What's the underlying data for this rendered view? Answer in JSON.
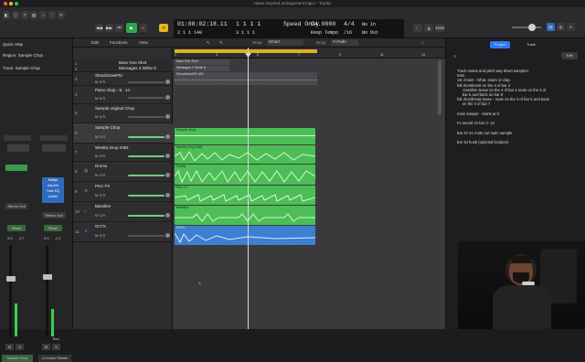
{
  "window": {
    "title": "Hawo inspired arrangement logicr - Tracks"
  },
  "transport": {
    "time": "01:00:02:18.11",
    "time_sub": "2  1  1  140",
    "bars_top": "1  1  1    1",
    "bars_bottom": "3  1  1    1",
    "speed_label": "Speed Only",
    "tempo": "94.0000",
    "keep_tempo": "Keep Tempo",
    "signature_top": "4/4",
    "signature_bottom": "/16",
    "no_in": "No In",
    "no_out": "No Out"
  },
  "toolbar": {
    "edit": "Edit",
    "functions": "Functions",
    "view": "View",
    "snap_label": "Snap:",
    "snap_value": "Smart",
    "drag_label": "Drag:",
    "drag_value": "X-Fade"
  },
  "inspector": {
    "quick_help": "Quick Help",
    "region_label": "Region: Sample Chop",
    "track_label": "Track: Sample Chop",
    "stereo_out": "Stereo Out",
    "stereo_out_alt": "Stereo Out",
    "read_a": "Read",
    "read_b": "Read",
    "val_a": "0.0",
    "val_b": "-0.7",
    "val_c": "0.0",
    "val_d": "-2.1",
    "plugins": [
      "Multipr",
      "AdLimit",
      "Tube EQ",
      "Limiter"
    ],
    "channel_a_name": "Sample Chop",
    "channel_b_name": "Lil Urban Streets",
    "bnc": "Bnc",
    "m_label": "M",
    "s_label": "S"
  },
  "tracks": [
    {
      "num": "1",
      "name": "Bass One Shot"
    },
    {
      "num": "2",
      "name": "Messages 2 White 8"
    },
    {
      "num": "3",
      "name": "ShockDrawPt2"
    },
    {
      "num": "4",
      "name": "Piano chop - 9, -14"
    },
    {
      "num": "5",
      "name": "Sample original Chop"
    },
    {
      "num": "6",
      "name": "Sample Chop"
    },
    {
      "num": "7",
      "name": "Weekly Drop #481"
    },
    {
      "num": "8",
      "name": "Drums"
    },
    {
      "num": "9",
      "name": "Perc FX"
    },
    {
      "num": "10",
      "name": "Bassline"
    },
    {
      "num": "11",
      "name": "Gt FX"
    }
  ],
  "regions": [
    {
      "name": "Sample Chop"
    },
    {
      "name": "Weekly Drop #481"
    },
    {
      "name": "Drums"
    },
    {
      "name": "Perc FX"
    },
    {
      "name": "Bassline"
    },
    {
      "name": "Gt FX"
    },
    {
      "name": "Bass One Shot"
    },
    {
      "name": "Messages 2 White 8"
    },
    {
      "name": "ShockDrawPt2 #01"
    }
  ],
  "ruler": {
    "marks": [
      "1",
      "3",
      "5",
      "7",
      "9",
      "11",
      "13"
    ]
  },
  "notes_panel": {
    "tab_project": "Project",
    "tab_track": "Track",
    "edit_label": "Edit",
    "text": "Track mutes and pitch way down samples:\nIntro\n1st 4 bars - hihat, snare or clap\nfull drumbreak on the 4 of bar 4\n     -bassline tease on the 4 of bar 4 mute on the 3 of\n     bar 5 and back on bar 8\nfull drumbreak tease - mute on the 3 of bar 5 and back\n     on the 3 of bar 7\n\nmain sample - starts at 9\n\nFx sound on bar 2- 12\n\nbar 37-41 mute out main sample\n\nbar 44 hook (optional location)"
  },
  "colors": {
    "region_green": "#4cbe55",
    "region_blue": "#3d7fd1",
    "wave_light": "#d8f5da",
    "lcd_bg": "#131315",
    "accent": "#2f7bf6"
  }
}
